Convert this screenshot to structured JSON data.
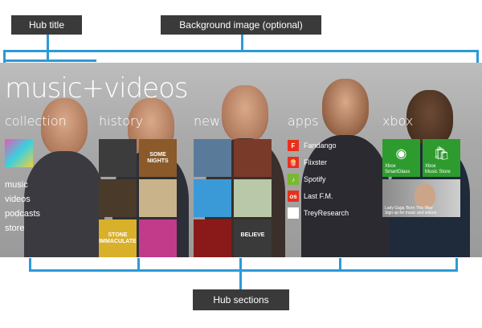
{
  "colors": {
    "bracket": "#2c9ad8",
    "callout_bg": "#3a3a3a",
    "xbox_green": "#2e9b2e"
  },
  "callouts": {
    "top_left_label": "Hub title",
    "top_right_label": "Background image (optional)",
    "bottom_label": "Hub sections"
  },
  "hub": {
    "title": "music+videos",
    "sections": {
      "collection": {
        "title": "collection",
        "links": [
          "music",
          "videos",
          "podcasts",
          "store"
        ]
      },
      "history": {
        "title": "history"
      },
      "new": {
        "title": "new"
      },
      "apps": {
        "title": "apps",
        "items": [
          {
            "label": "Fandango",
            "icon": "fandango-icon",
            "color": "#e8301c",
            "glyph": "F"
          },
          {
            "label": "Flixster",
            "icon": "flixster-icon",
            "color": "#e8301c",
            "glyph": "🍿"
          },
          {
            "label": "Spotify",
            "icon": "spotify-icon",
            "color": "#7ab833",
            "glyph": "♪"
          },
          {
            "label": "Last F.M.",
            "icon": "lastfm-icon",
            "color": "#e8301c",
            "glyph": "os"
          },
          {
            "label": "TreyResearch",
            "icon": "treyresearch-icon",
            "color": "#ffffff",
            "glyph": ""
          }
        ]
      },
      "xbox": {
        "title": "xbox",
        "tiles": [
          {
            "caption_line1": "Xbox",
            "caption_line2": "SmartGlass",
            "icon": "smartglass-icon"
          },
          {
            "caption_line1": "Xbox",
            "caption_line2": "Music Store",
            "icon": "shopping-bag-icon"
          }
        ],
        "featured": {
          "line1": "Lady Gaga 'Born This Way'",
          "line2": "Sign up for music and videos"
        }
      }
    },
    "history_tiles": [
      {
        "name": "album-tile-born-this-way",
        "bg": "#3c3c3c",
        "text": ""
      },
      {
        "name": "album-tile-some-nights",
        "bg": "#8a5a2a",
        "text": "SOME NIGHTS"
      },
      {
        "name": "album-tile-50-cent",
        "bg": "#4a3a2a",
        "text": ""
      },
      {
        "name": "album-tile-kesha",
        "bg": "#c9b38a",
        "text": ""
      },
      {
        "name": "album-tile-stone-immaculate",
        "bg": "#d8b02a",
        "text": "STONE IMMACULATE"
      },
      {
        "name": "album-tile-colorful",
        "bg": "#c23a8a",
        "text": ""
      }
    ],
    "new_tiles": [
      {
        "name": "album-tile-blake-shelton",
        "bg": "#5a7a9a",
        "text": ""
      },
      {
        "name": "album-tile-florence",
        "bg": "#7a3a2a",
        "text": ""
      },
      {
        "name": "album-tile-glee",
        "bg": "#3a9ad8",
        "text": ""
      },
      {
        "name": "album-tile-pattern",
        "bg": "#b8c8a8",
        "text": ""
      },
      {
        "name": "album-tile-red",
        "bg": "#8a1a1a",
        "text": ""
      },
      {
        "name": "album-tile-believe",
        "bg": "#3a3a3a",
        "text": "BELIEVE"
      }
    ]
  }
}
